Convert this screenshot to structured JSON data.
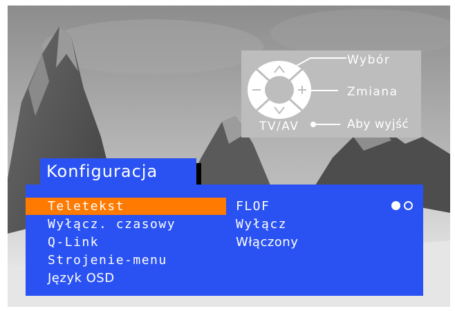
{
  "remote_legend": {
    "select_label": "Wybór",
    "change_label": "Zmiana",
    "tvav_label": "TV/AV",
    "exit_label": "Aby wyjść"
  },
  "menu": {
    "title": "Konfiguracja",
    "items": [
      {
        "label": "Teletekst",
        "value": "FLOF",
        "selected": true
      },
      {
        "label": "Wyłącz. czasowy",
        "value": "Wyłącz"
      },
      {
        "label": "Q-Link",
        "value": "Włączony"
      },
      {
        "label": "Strojenie-menu"
      },
      {
        "label": "Język OSD"
      }
    ],
    "page_indicator": {
      "current": 1,
      "total": 2
    }
  },
  "colors": {
    "panel": "#2a52f2",
    "highlight": "#ff7a00",
    "text": "#ffffff"
  }
}
